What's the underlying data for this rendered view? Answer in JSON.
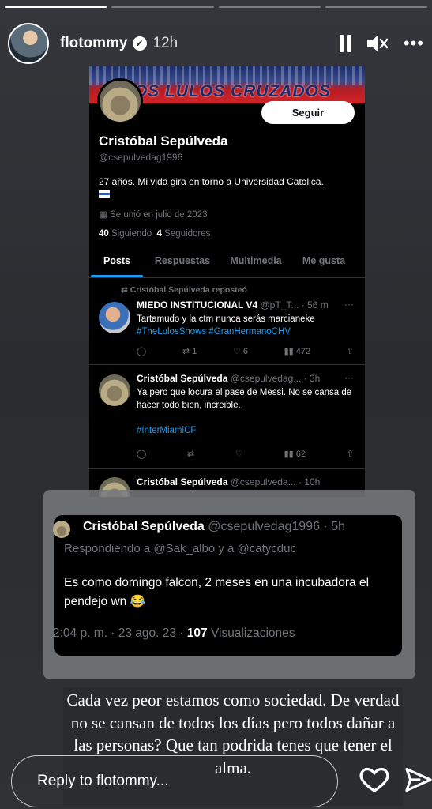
{
  "story": {
    "username": "flotommy",
    "time_ago": "12h",
    "caption": "Cada vez peor estamos como sociedad. De verdad no se cansan de todos los días pero todos dañar a las personas? Que tan podrida tenes que tener el alma.",
    "reply_placeholder": "Reply to flotommy..."
  },
  "twitter_profile": {
    "banner_text": "LOS LULOS CRUZADOS",
    "follow_label": "Seguir",
    "name": "Cristóbal Sepúlveda",
    "handle": "@csepulvedag1996",
    "bio": "27 años. Mi vida gira en torno a Universidad Catolica.",
    "joined": "Se unió en julio de 2023",
    "following_count": "40",
    "following_label": "Siguiendo",
    "followers_count": "4",
    "followers_label": "Seguidores",
    "tabs": [
      "Posts",
      "Respuestas",
      "Multimedia",
      "Me gusta"
    ],
    "tweets": [
      {
        "repost_label": "Cristóbal Sepúlveda reposteó",
        "name": "MIEDO INSTITUCIONAL V4",
        "handle": "@pT_T...",
        "time": "· 56 m",
        "text": "Tartamudo y la ctm nunca serás marcianeke",
        "hashtags": "#TheLulosShows #GranHermanoCHV",
        "retweets": "1",
        "likes": "6",
        "views": "472"
      },
      {
        "name": "Cristóbal Sepúlveda",
        "handle": "@csepulvedag...",
        "time": "· 3h",
        "text": "Ya pero que locura el pase de Messi. No se cansa de hacer todo bien, increible..",
        "hashtags": "#InterMiamiCF",
        "views": "62"
      },
      {
        "name": "Cristóbal Sepúlveda",
        "handle": "@csepulveda...",
        "time": "· 10h"
      }
    ]
  },
  "quoted_tweet": {
    "name": "Cristóbal Sepúlveda",
    "handle": "@csepulvedag1996",
    "time": "· 5h",
    "reply_to": "Respondiendo a @Sak_albo y a @catycduc",
    "text": "Es como domingo falcon, 2 meses en una incubadora el pendejo wn 😂",
    "meta": "2:04 p. m. · 23 ago. 23 ·",
    "views_count": "107",
    "views_label": "Visualizaciones"
  }
}
